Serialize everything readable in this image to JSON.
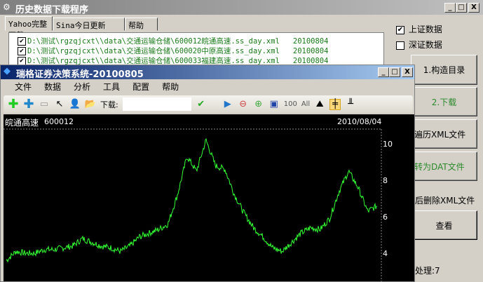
{
  "main_window": {
    "title": "历史数据下载程序",
    "min": "_",
    "max": "□",
    "close": "X"
  },
  "tabs": [
    {
      "label": "Yahoo完整下载"
    },
    {
      "label": "Sina今日更新"
    },
    {
      "label": "帮助"
    }
  ],
  "tree_items": [
    {
      "path": "D:\\测试\\rgzqjcxt\\\\data\\交通运输仓储\\600012皖通高速.ss_day.xml",
      "date": "20100804",
      "checked": true
    },
    {
      "path": "D:\\测试\\rgzqjcxt\\\\data\\交通运输仓储\\600020中原高速.ss_day.xml",
      "date": "20100804",
      "checked": true
    },
    {
      "path": "D:\\测试\\rgzqjcxt\\\\data\\交通运输仓储\\600033福建高速.ss_day.xml",
      "date": "20100804",
      "checked": true
    }
  ],
  "options": {
    "shanghai": {
      "label": "上证数据",
      "checked": true
    },
    "shenzhen": {
      "label": "深证数据",
      "checked": false
    }
  },
  "buttons": {
    "build": "1.构造目录",
    "download": "2.下载",
    "traverse": "遍历XML文件",
    "convert": "转为DAT文件",
    "view": "查看"
  },
  "delete_xml_label": "后删除XML文件",
  "processed_label": "处理:7",
  "child_window": {
    "title": "瑞格证券决策系统-20100805",
    "min": "_",
    "max": "□",
    "close": "X"
  },
  "menu": [
    "文件",
    "数据",
    "分析",
    "工具",
    "配置",
    "帮助"
  ],
  "toolbar": {
    "download_label": "下载:",
    "download_value": "",
    "zoom_100": "100",
    "zoom_all": "All"
  },
  "chart_data": {
    "type": "line",
    "title": "皖通高速",
    "code": "600012",
    "date": "2010/08/04",
    "ylim": [
      2.8,
      11.5
    ],
    "yticks": [
      4,
      6,
      8,
      10
    ],
    "color": "#33ff33",
    "values": [
      3.6,
      4.1,
      4.0,
      4.0,
      4.2,
      4.2,
      4.3,
      4.4,
      4.8,
      4.6,
      4.4,
      4.3,
      4.1,
      4.4,
      4.9,
      5.1,
      5.3,
      5.6,
      7.2,
      9.3,
      8.5,
      10.2,
      8.8,
      8.6,
      7.2,
      6.2,
      5.4,
      4.9,
      4.3,
      4.1,
      4.6,
      5.1,
      5.4,
      5.3,
      5.9,
      7.4,
      8.5,
      7.6,
      6.3,
      6.6
    ]
  }
}
